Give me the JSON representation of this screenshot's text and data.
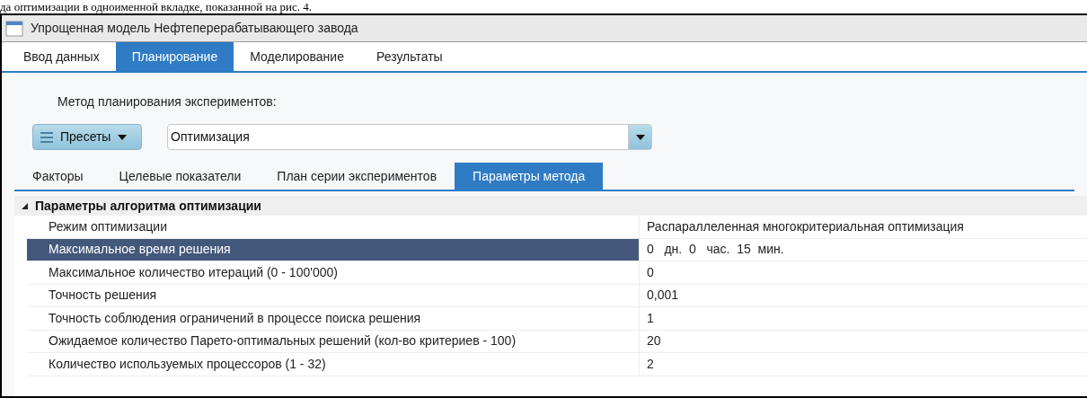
{
  "document_text": "да оптимизации в одноименной вкладке, показанной на рис. 4.",
  "window": {
    "title": "Упрощенная модель Нефтеперерабатывающего завода"
  },
  "tabs": [
    {
      "label": "Ввод данных",
      "selected": false
    },
    {
      "label": "Планирование",
      "selected": true
    },
    {
      "label": "Моделирование",
      "selected": false
    },
    {
      "label": "Результаты",
      "selected": false
    }
  ],
  "method_label": "Метод планирования экспериментов:",
  "presets_button": "Пресеты",
  "method_select": {
    "value": "Оптимизация"
  },
  "subtabs": [
    {
      "label": "Факторы",
      "selected": false
    },
    {
      "label": "Целевые показатели",
      "selected": false
    },
    {
      "label": "План серии экспериментов",
      "selected": false
    },
    {
      "label": "Параметры метода",
      "selected": true
    }
  ],
  "property_grid": {
    "group": {
      "title": "Параметры алгоритма оптимизации",
      "expanded": true
    },
    "rows": [
      {
        "name": "Режим оптимизации",
        "value": "Распараллеленная многокритериальная оптимизация",
        "selected": false
      },
      {
        "name": "Максимальное время решения",
        "value": "0   дн.  0   час.  15  мин.",
        "selected": true
      },
      {
        "name": "Максимальное количество итераций (0 - 100'000)",
        "value": "0",
        "selected": false
      },
      {
        "name": "Точность решения",
        "value": "0,001",
        "selected": false
      },
      {
        "name": "Точность соблюдения ограничений в процессе поиска решения",
        "value": "1",
        "selected": false
      },
      {
        "name": "Ожидаемое количество Парето-оптимальных решений (кол-во критериев - 100)",
        "value": "20",
        "selected": false
      },
      {
        "name": "Количество используемых процессоров (1 - 32)",
        "value": "2",
        "selected": false
      }
    ]
  }
}
